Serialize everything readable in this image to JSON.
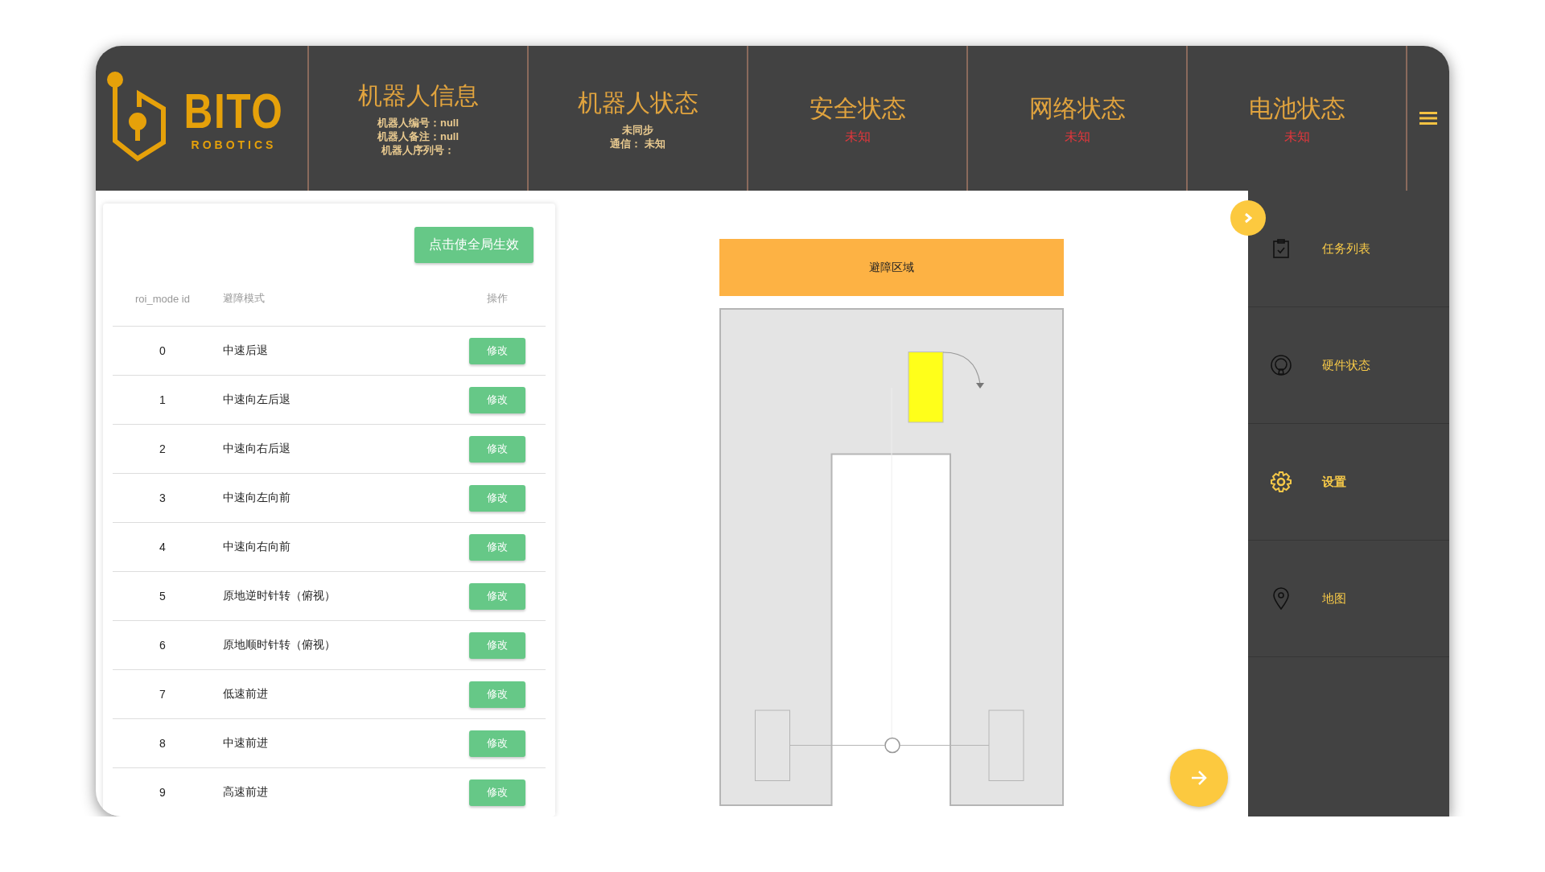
{
  "logo": {
    "name": "BITO",
    "tagline": "ROBOTICS"
  },
  "header_sections": [
    {
      "title": "机器人信息",
      "lines": [
        {
          "text": "机器人编号：null",
          "kind": "info"
        },
        {
          "text": "机器人备注：null",
          "kind": "info"
        },
        {
          "text": "机器人序列号：",
          "kind": "info"
        }
      ]
    },
    {
      "title": "机器人状态",
      "lines": [
        {
          "text": "未同步",
          "kind": "info"
        },
        {
          "text": "通信： 未知",
          "kind": "info"
        }
      ]
    },
    {
      "title": "安全状态",
      "lines": [
        {
          "text": "未知",
          "kind": "alert"
        }
      ]
    },
    {
      "title": "网络状态",
      "lines": [
        {
          "text": "未知",
          "kind": "alert"
        }
      ]
    },
    {
      "title": "电池状态",
      "lines": [
        {
          "text": "未知",
          "kind": "alert"
        }
      ]
    }
  ],
  "table": {
    "apply_button": "点击使全局生效",
    "columns": [
      "roi_mode id",
      "避障模式",
      "操作"
    ],
    "rows": [
      {
        "id": "0",
        "mode": "中速后退",
        "action": "修改"
      },
      {
        "id": "1",
        "mode": "中速向左后退",
        "action": "修改"
      },
      {
        "id": "2",
        "mode": "中速向右后退",
        "action": "修改"
      },
      {
        "id": "3",
        "mode": "中速向左向前",
        "action": "修改"
      },
      {
        "id": "4",
        "mode": "中速向右向前",
        "action": "修改"
      },
      {
        "id": "5",
        "mode": "原地逆时针转（俯视）",
        "action": "修改"
      },
      {
        "id": "6",
        "mode": "原地顺时针转（俯视）",
        "action": "修改"
      },
      {
        "id": "7",
        "mode": "低速前进",
        "action": "修改"
      },
      {
        "id": "8",
        "mode": "中速前进",
        "action": "修改"
      },
      {
        "id": "9",
        "mode": "高速前进",
        "action": "修改"
      }
    ]
  },
  "diagram": {
    "title": "避障区域"
  },
  "sidebar": {
    "items": [
      {
        "label": "任务列表",
        "kind": "tasks",
        "selected": false
      },
      {
        "label": "硬件状态",
        "kind": "hardware",
        "selected": false
      },
      {
        "label": "设置",
        "kind": "settings",
        "selected": true
      },
      {
        "label": "地图",
        "kind": "map",
        "selected": false
      }
    ]
  }
}
